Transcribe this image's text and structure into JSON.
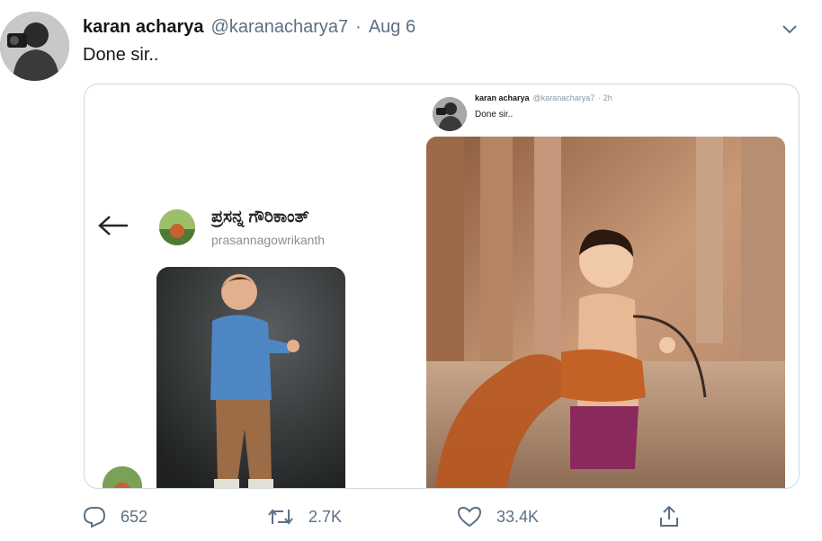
{
  "tweet": {
    "author_name": "karan acharya",
    "author_handle": "@karanacharya7",
    "separator": "·",
    "date": "Aug 6",
    "text": "Done sir.."
  },
  "media": {
    "left_card": {
      "name": "ಪ್ರಸನ್ನ ಗೌರಿಕಾಂತ್",
      "handle": "prasannagowrikanth"
    },
    "quoted_tweet": {
      "author_name": "karan acharya",
      "author_handle": "@karanacharya7",
      "time": "· 2h",
      "text": "Done sir.."
    }
  },
  "actions": {
    "replies": "652",
    "retweets": "2.7K",
    "likes": "33.4K"
  },
  "colors": {
    "text_primary": "#14171a",
    "text_secondary": "#5b7083",
    "border": "#cfd9de"
  },
  "icons": [
    "chevron-down-icon",
    "back-arrow-icon",
    "reply-icon",
    "retweet-icon",
    "like-icon",
    "share-icon"
  ]
}
